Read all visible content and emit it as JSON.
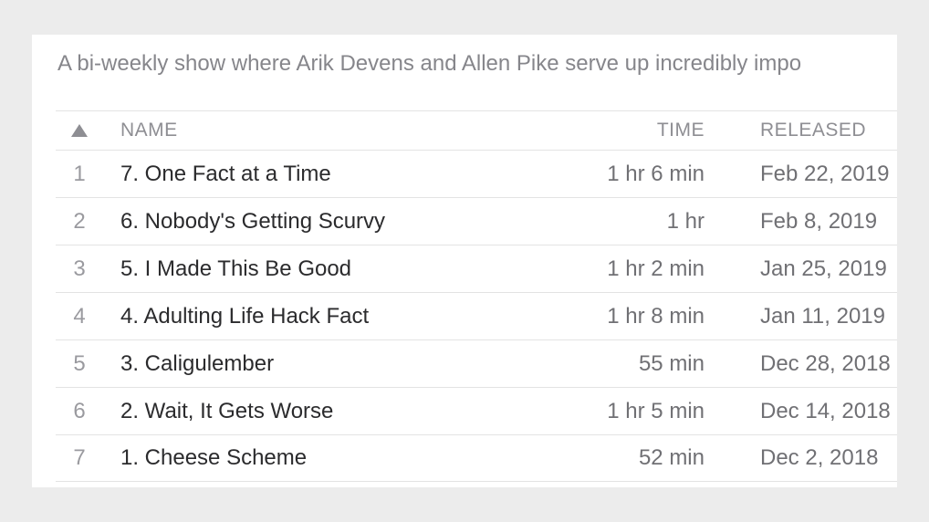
{
  "description": "A bi-weekly show where Arik Devens and Allen Pike serve up incredibly impo",
  "columns": {
    "name": "NAME",
    "time": "TIME",
    "released": "RELEASED"
  },
  "sort_icon": "triangle-up-icon",
  "episodes": [
    {
      "num": "1",
      "name": "7. One Fact at a Time",
      "time": "1 hr 6 min",
      "released": "Feb 22, 2019"
    },
    {
      "num": "2",
      "name": "6. Nobody's Getting Scurvy",
      "time": "1 hr",
      "released": "Feb 8, 2019"
    },
    {
      "num": "3",
      "name": "5. I Made This Be Good",
      "time": "1 hr 2 min",
      "released": "Jan 25, 2019"
    },
    {
      "num": "4",
      "name": "4. Adulting Life Hack Fact",
      "time": "1 hr 8 min",
      "released": "Jan 11, 2019"
    },
    {
      "num": "5",
      "name": "3. Caligulember",
      "time": "55 min",
      "released": "Dec 28, 2018"
    },
    {
      "num": "6",
      "name": "2. Wait, It Gets Worse",
      "time": "1 hr 5 min",
      "released": "Dec 14, 2018"
    },
    {
      "num": "7",
      "name": "1. Cheese Scheme",
      "time": "52 min",
      "released": "Dec 2, 2018"
    }
  ]
}
